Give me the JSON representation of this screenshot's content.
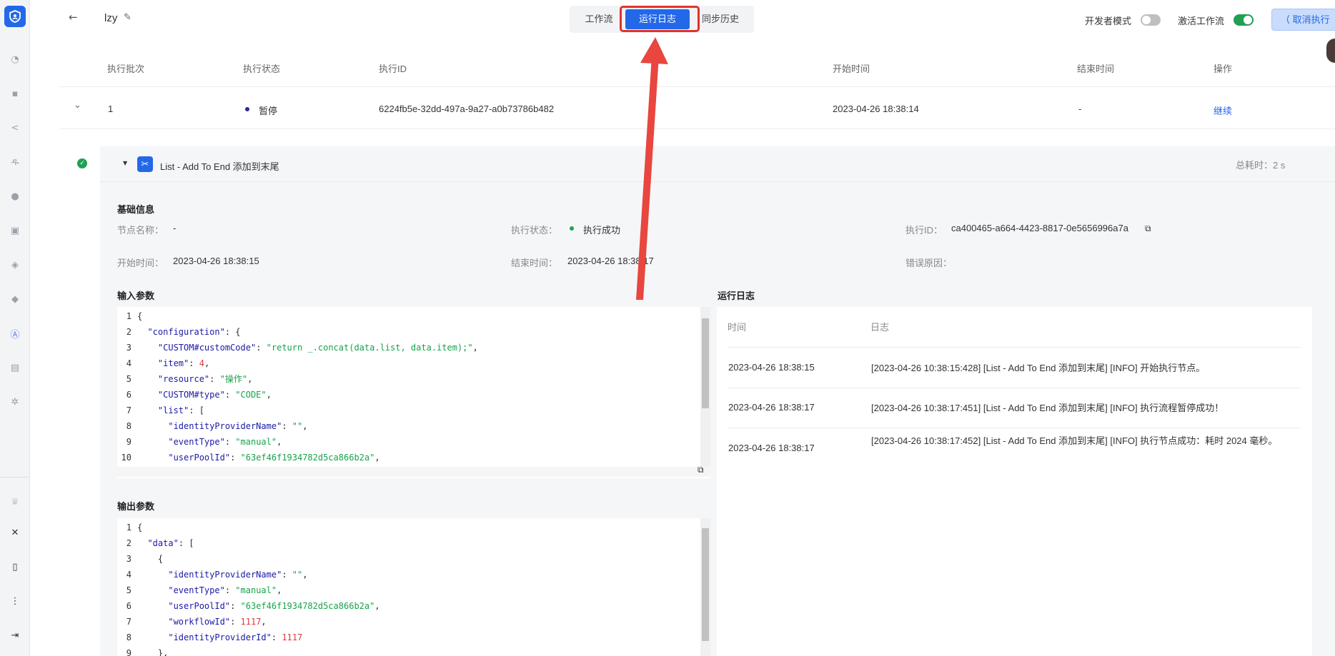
{
  "header": {
    "title": "lzy",
    "tabs": [
      "工作流",
      "运行日志",
      "同步历史"
    ],
    "dev_mode_label": "开发者模式",
    "activate_label": "激活工作流",
    "cancel_button": "（  取消执行"
  },
  "table": {
    "headers": [
      "执行批次",
      "执行状态",
      "执行ID",
      "开始时间",
      "结束时间",
      "操作"
    ],
    "row": {
      "batch": "1",
      "status": "暂停",
      "exec_id": "6224fb5e-32dd-497a-9a27-a0b73786b482",
      "start_time": "2023-04-26 18:38:14",
      "end_time": "-",
      "action": "继续"
    }
  },
  "node": {
    "title": "List - Add To End 添加到末尾",
    "total_time": "总耗时：2 s",
    "basic_info_title": "基础信息",
    "node_name_label": "节点名称：",
    "node_name_value": "-",
    "exec_status_label": "执行状态：",
    "exec_status_value": "执行成功",
    "exec_id_label": "执行ID：",
    "exec_id_value": "ca400465-a664-4423-8817-0e5656996a7a",
    "start_label": "开始时间：",
    "start_value": "2023-04-26 18:38:15",
    "end_label": "结束时间：",
    "end_value": "2023-04-26 18:38:17",
    "error_label": "错误原因：",
    "input_title": "输入参数",
    "output_title": "输出参数",
    "log_title": "运行日志"
  },
  "input_code": [
    {
      "n": "1",
      "indent": 0,
      "parts": [
        [
          "p",
          "{"
        ]
      ]
    },
    {
      "n": "2",
      "indent": 1,
      "parts": [
        [
          "k",
          "\"configuration\""
        ],
        [
          "p",
          ": {"
        ]
      ]
    },
    {
      "n": "3",
      "indent": 2,
      "parts": [
        [
          "k",
          "\"CUSTOM#customCode\""
        ],
        [
          "p",
          ": "
        ],
        [
          "s",
          "\"return _.concat(data.list, data.item);\""
        ],
        [
          "p",
          ","
        ]
      ]
    },
    {
      "n": "4",
      "indent": 2,
      "parts": [
        [
          "k",
          "\"item\""
        ],
        [
          "p",
          ": "
        ],
        [
          "n",
          "4"
        ],
        [
          "p",
          ","
        ]
      ]
    },
    {
      "n": "5",
      "indent": 2,
      "parts": [
        [
          "k",
          "\"resource\""
        ],
        [
          "p",
          ": "
        ],
        [
          "s",
          "\"操作\""
        ],
        [
          "p",
          ","
        ]
      ]
    },
    {
      "n": "6",
      "indent": 2,
      "parts": [
        [
          "k",
          "\"CUSTOM#type\""
        ],
        [
          "p",
          ": "
        ],
        [
          "s",
          "\"CODE\""
        ],
        [
          "p",
          ","
        ]
      ]
    },
    {
      "n": "7",
      "indent": 2,
      "parts": [
        [
          "k",
          "\"list\""
        ],
        [
          "p",
          ": ["
        ]
      ]
    },
    {
      "n": "8",
      "indent": 3,
      "parts": [
        [
          "k",
          "\"identityProviderName\""
        ],
        [
          "p",
          ": "
        ],
        [
          "s",
          "\"\""
        ],
        [
          "p",
          ","
        ]
      ]
    },
    {
      "n": "9",
      "indent": 3,
      "parts": [
        [
          "k",
          "\"eventType\""
        ],
        [
          "p",
          ": "
        ],
        [
          "s",
          "\"manual\""
        ],
        [
          "p",
          ","
        ]
      ]
    },
    {
      "n": "10",
      "indent": 3,
      "parts": [
        [
          "k",
          "\"userPoolId\""
        ],
        [
          "p",
          ": "
        ],
        [
          "s",
          "\"63ef46f1934782d5ca866b2a\""
        ],
        [
          "p",
          ","
        ]
      ]
    }
  ],
  "output_code": [
    {
      "n": "1",
      "indent": 0,
      "parts": [
        [
          "p",
          "{"
        ]
      ]
    },
    {
      "n": "2",
      "indent": 1,
      "parts": [
        [
          "k",
          "\"data\""
        ],
        [
          "p",
          ": ["
        ]
      ]
    },
    {
      "n": "3",
      "indent": 2,
      "parts": [
        [
          "p",
          "{"
        ]
      ]
    },
    {
      "n": "4",
      "indent": 3,
      "parts": [
        [
          "k",
          "\"identityProviderName\""
        ],
        [
          "p",
          ": "
        ],
        [
          "s",
          "\"\""
        ],
        [
          "p",
          ","
        ]
      ]
    },
    {
      "n": "5",
      "indent": 3,
      "parts": [
        [
          "k",
          "\"eventType\""
        ],
        [
          "p",
          ": "
        ],
        [
          "s",
          "\"manual\""
        ],
        [
          "p",
          ","
        ]
      ]
    },
    {
      "n": "6",
      "indent": 3,
      "parts": [
        [
          "k",
          "\"userPoolId\""
        ],
        [
          "p",
          ": "
        ],
        [
          "s",
          "\"63ef46f1934782d5ca866b2a\""
        ],
        [
          "p",
          ","
        ]
      ]
    },
    {
      "n": "7",
      "indent": 3,
      "parts": [
        [
          "k",
          "\"workflowId\""
        ],
        [
          "p",
          ": "
        ],
        [
          "n",
          "1117"
        ],
        [
          "p",
          ","
        ]
      ]
    },
    {
      "n": "8",
      "indent": 3,
      "parts": [
        [
          "k",
          "\"identityProviderId\""
        ],
        [
          "p",
          ": "
        ],
        [
          "n",
          "1117"
        ]
      ]
    },
    {
      "n": "9",
      "indent": 2,
      "parts": [
        [
          "p",
          "},"
        ]
      ]
    }
  ],
  "logs": {
    "headers": [
      "时间",
      "日志"
    ],
    "rows": [
      {
        "time": "2023-04-26 18:38:15",
        "msg": "[2023-04-26 10:38:15:428] [List - Add To End 添加到末尾] [INFO] 开始执行节点。"
      },
      {
        "time": "2023-04-26 18:38:17",
        "msg": "[2023-04-26 10:38:17:451] [List - Add To End 添加到末尾] [INFO] 执行流程暂停成功！"
      },
      {
        "time": "2023-04-26 18:38:17",
        "msg": "[2023-04-26 10:38:17:452] [List - Add To End 添加到末尾] [INFO] 执行节点成功：耗时 2024 毫秒。"
      }
    ]
  },
  "colors": {
    "accent": "#2368e8",
    "success": "#20a052",
    "highlight": "#e2312c"
  },
  "icons": {
    "sidebar": [
      "shield-logo-icon",
      "pie-chart-icon",
      "apps-icon",
      "share-icon",
      "org-tree-icon",
      "globe-icon",
      "lock-icon",
      "shield-check-icon",
      "rocket-icon",
      "letter-a-icon",
      "document-icon",
      "settings-icon",
      "plugin-icon",
      "tools-icon",
      "book-icon",
      "more-icon",
      "collapse-icon"
    ]
  }
}
